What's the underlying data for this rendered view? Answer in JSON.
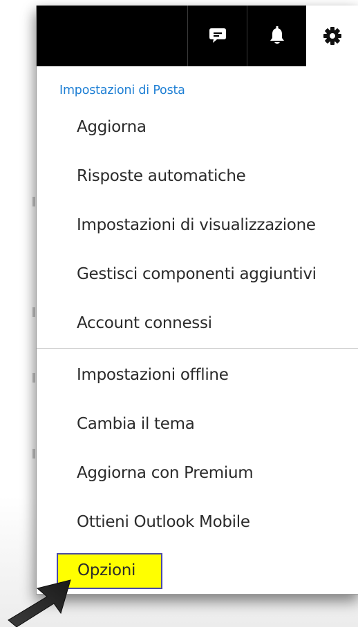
{
  "header": {
    "icons": [
      "chat-icon",
      "bell-icon",
      "gear-icon"
    ]
  },
  "settings_menu": {
    "section_title": "Impostazioni di Posta",
    "items": [
      "Aggiorna",
      "Risposte automatiche",
      "Impostazioni di visualizzazione",
      "Gestisci componenti aggiuntivi",
      "Account connessi",
      "Impostazioni offline",
      "Cambia il tema",
      "Aggiorna con Premium",
      "Ottieni Outlook Mobile",
      "Opzioni"
    ]
  },
  "colors": {
    "topbar": "#000000",
    "section_title": "#1e7fd4",
    "highlight": "#ffff00",
    "highlight_border": "#4a4aa6"
  }
}
